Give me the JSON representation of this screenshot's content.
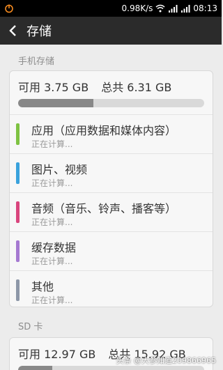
{
  "status_bar": {
    "speed": "0.98K/s",
    "time": "08:13",
    "icons": [
      "power-icon",
      "wifi-icon",
      "signal-icon",
      "signal-icon"
    ]
  },
  "title_bar": {
    "title": "存储",
    "back_icon": "chevron-left-icon"
  },
  "phone_storage": {
    "header": "手机存储",
    "available": "可用 3.75 GB",
    "total": "总共 6.31 GB",
    "used_fraction": 0.406,
    "items": [
      {
        "label": "应用（应用数据和媒体内容）",
        "status": "正在计算...",
        "color": "#7ec242"
      },
      {
        "label": "图片、视频",
        "status": "正在计算...",
        "color": "#3aa2dc"
      },
      {
        "label": "音频（音乐、铃声、播客等）",
        "status": "正在计算...",
        "color": "#d9457d"
      },
      {
        "label": "缓存数据",
        "status": "正在计算...",
        "color": "#a579d1"
      },
      {
        "label": "其他",
        "status": "正在计算...",
        "color": "#8d97a8"
      }
    ]
  },
  "sd_card": {
    "header": "SD 卡",
    "available": "可用 12.97 GB",
    "total": "总共 15.92 GB",
    "used_fraction": 0.185
  },
  "watermark": "头条 @大参知道209866965",
  "colors": {
    "status_bg": "#000000",
    "title_bg": "#2b2b2b",
    "page_bg": "#ececec"
  }
}
